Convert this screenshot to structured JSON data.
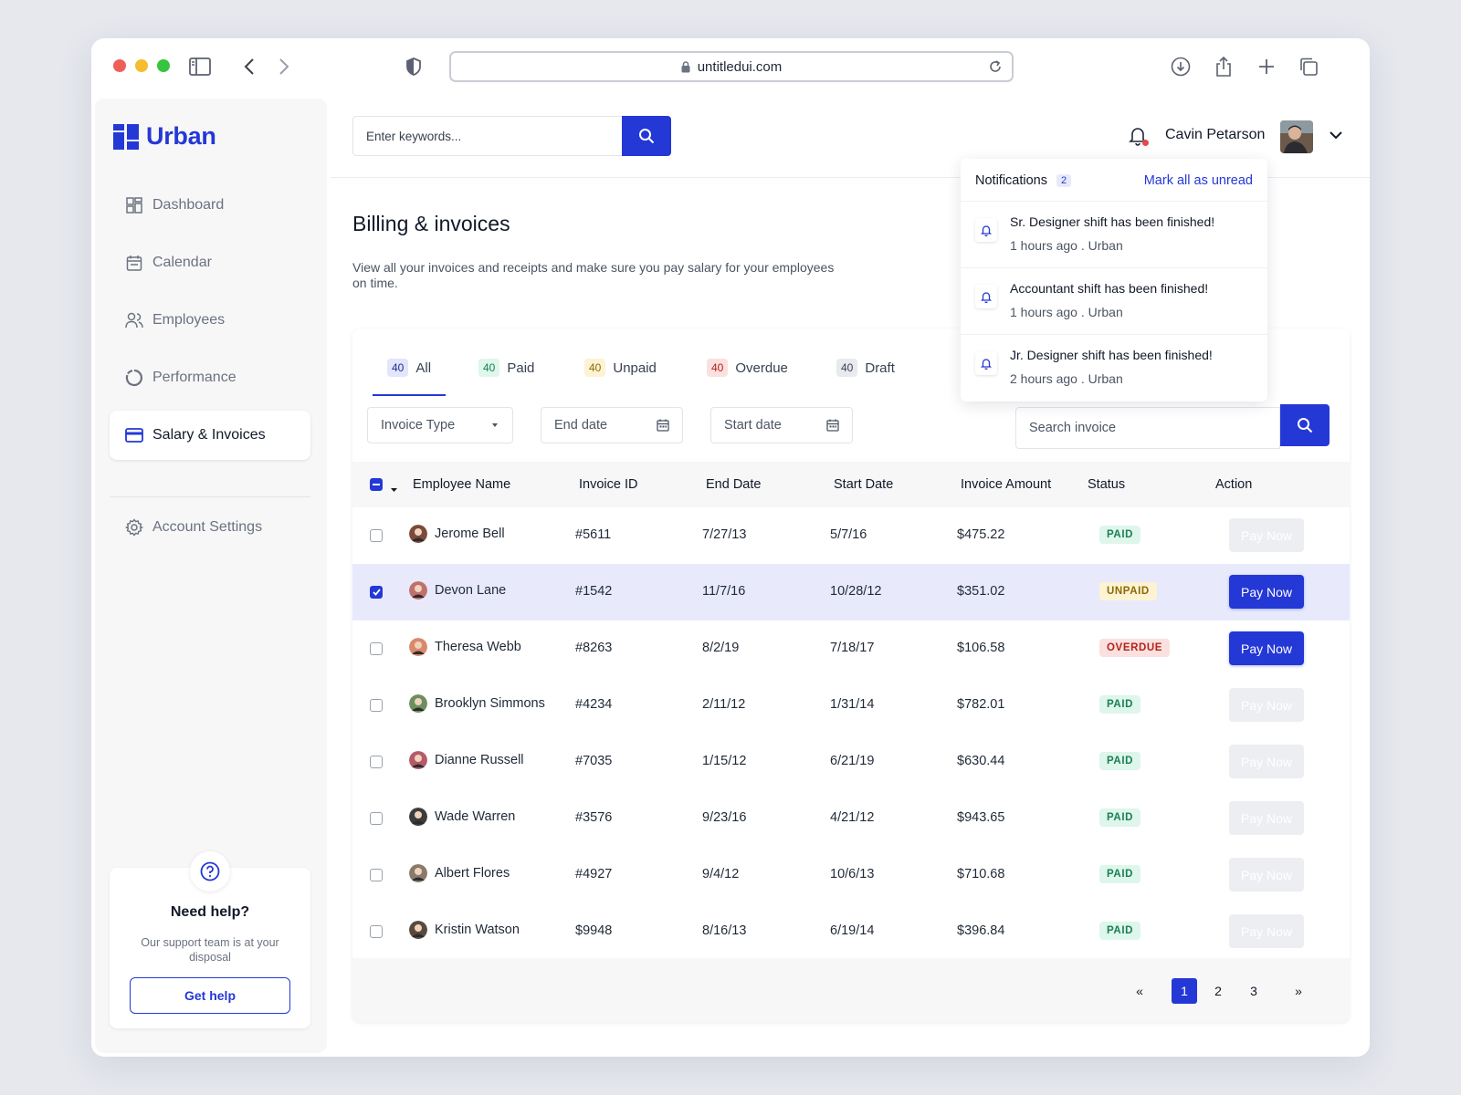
{
  "browser": {
    "url": "untitledui.com"
  },
  "sidebar": {
    "brand": "Urban",
    "items": [
      {
        "label": "Dashboard",
        "icon": "grid-icon"
      },
      {
        "label": "Calendar",
        "icon": "calendar-icon"
      },
      {
        "label": "Employees",
        "icon": "users-icon"
      },
      {
        "label": "Performance",
        "icon": "pie-icon"
      },
      {
        "label": "Salary & Invoices",
        "icon": "card-icon",
        "active": true
      }
    ],
    "settings": {
      "label": "Account Settings",
      "icon": "gear-icon"
    },
    "help": {
      "title": "Need help?",
      "text": "Our support team is at your disposal",
      "button": "Get help"
    }
  },
  "header": {
    "search_placeholder": "Enter keywords...",
    "user_name": "Cavin Petarson"
  },
  "page": {
    "title": "Billing & invoices",
    "description": "View all your invoices and receipts and make sure you pay salary for your employees on time."
  },
  "tabs": [
    {
      "count": "40",
      "label": "All",
      "active": true
    },
    {
      "count": "40",
      "label": "Paid"
    },
    {
      "count": "40",
      "label": "Unpaid"
    },
    {
      "count": "40",
      "label": "Overdue"
    },
    {
      "count": "40",
      "label": "Draft"
    }
  ],
  "filters": {
    "invoice_type": "Invoice Type",
    "end_date": "End date",
    "start_date": "Start date",
    "search_placeholder": "Search invoice"
  },
  "table": {
    "columns": [
      "Employee Name",
      "Invoice ID",
      "End Date",
      "Start Date",
      "Invoice Amount",
      "Status",
      "Action"
    ],
    "action_label": "Pay Now",
    "rows": [
      {
        "name": "Jerome Bell",
        "id": "#5611",
        "end": "7/27/13",
        "start": "5/7/16",
        "amount": "$475.22",
        "status": "PAID",
        "selected": false
      },
      {
        "name": "Devon Lane",
        "id": "#1542",
        "end": "11/7/16",
        "start": "10/28/12",
        "amount": "$351.02",
        "status": "UNPAID",
        "selected": true
      },
      {
        "name": "Theresa Webb",
        "id": "#8263",
        "end": "8/2/19",
        "start": "7/18/17",
        "amount": "$106.58",
        "status": "OVERDUE",
        "selected": false
      },
      {
        "name": "Brooklyn Simmons",
        "id": "#4234",
        "end": "2/11/12",
        "start": "1/31/14",
        "amount": "$782.01",
        "status": "PAID",
        "selected": false
      },
      {
        "name": "Dianne Russell",
        "id": "#7035",
        "end": "1/15/12",
        "start": "6/21/19",
        "amount": "$630.44",
        "status": "PAID",
        "selected": false
      },
      {
        "name": "Wade Warren",
        "id": "#3576",
        "end": "9/23/16",
        "start": "4/21/12",
        "amount": "$943.65",
        "status": "PAID",
        "selected": false
      },
      {
        "name": "Albert Flores",
        "id": "#4927",
        "end": "9/4/12",
        "start": "10/6/13",
        "amount": "$710.68",
        "status": "PAID",
        "selected": false
      },
      {
        "name": "Kristin Watson",
        "id": "$9948",
        "end": "8/16/13",
        "start": "6/19/14",
        "amount": "$396.84",
        "status": "PAID",
        "selected": false
      }
    ]
  },
  "pagination": {
    "first": "«",
    "pages": [
      "1",
      "2",
      "3"
    ],
    "current": "1",
    "last": "»"
  },
  "notifications": {
    "title": "Notifications",
    "count": "2",
    "mark_label": "Mark all as unread",
    "items": [
      {
        "text": "Sr. Designer shift has been finished!",
        "meta": "1 hours ago . Urban"
      },
      {
        "text": "Accountant shift has been finished!",
        "meta": "1 hours ago . Urban"
      },
      {
        "text": "Jr. Designer shift has been finished!",
        "meta": "2 hours ago . Urban"
      }
    ]
  },
  "colors": {
    "accent": "#2438d6",
    "paid_bg": "#def6ec",
    "unpaid_bg": "#fdf3d2",
    "overdue_bg": "#fbe0e0"
  }
}
